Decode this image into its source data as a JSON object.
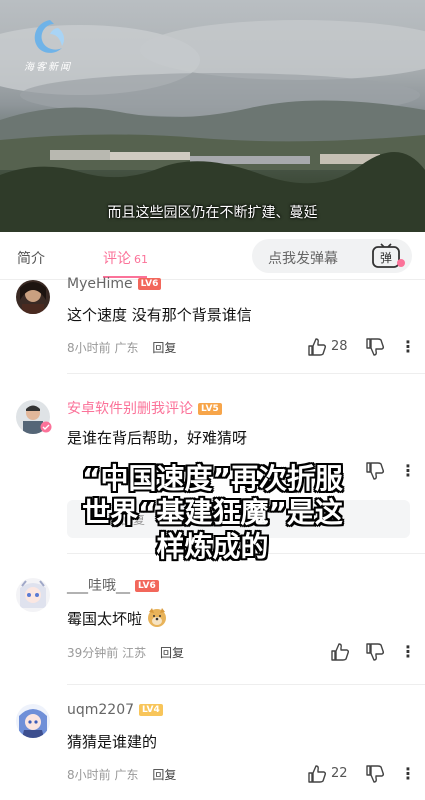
{
  "video": {
    "logo_text": "海客新闻",
    "subtitle": "而且这些园区仍在不断扩建、蔓延"
  },
  "tabs": {
    "intro": "简介",
    "comments": "评论",
    "comments_count": "61",
    "danmaku_placeholder": "点我发弹幕",
    "danmaku_button": "弹"
  },
  "comments": [
    {
      "user": "MyeHime",
      "level": "LV6",
      "level_color": "#f2675b",
      "name_color": "#666666",
      "text": "这个速度  没有那个背景谁信",
      "time": "8小时前",
      "location": "广东",
      "reply": "回复",
      "likes": "28"
    },
    {
      "user": "安卓软件别删我评论",
      "level": "LV5",
      "level_color": "#f7a54a",
      "name_color": "#fb7299",
      "text": "是谁在背后帮助，好难猜呀",
      "reply_preview": "回复"
    },
    {
      "user": "___哇哦__",
      "level": "LV6",
      "level_color": "#f2675b",
      "name_color": "#666666",
      "text": "霉国太坏啦",
      "time": "39分钟前",
      "location": "江苏",
      "reply": "回复",
      "likes": ""
    },
    {
      "user": "uqm2207",
      "level": "LV4",
      "level_color": "#f8c55a",
      "name_color": "#666666",
      "text": "猜猜是谁建的",
      "time": "8小时前",
      "location": "广东",
      "reply": "回复",
      "likes": "22"
    }
  ],
  "overlay": {
    "line1": "“中国速度”再次折服",
    "line2": "世界“基建狂魔”是这",
    "line3": "样炼成的"
  },
  "colors": {
    "accent": "#fb7299",
    "divider": "#eeeeee"
  }
}
